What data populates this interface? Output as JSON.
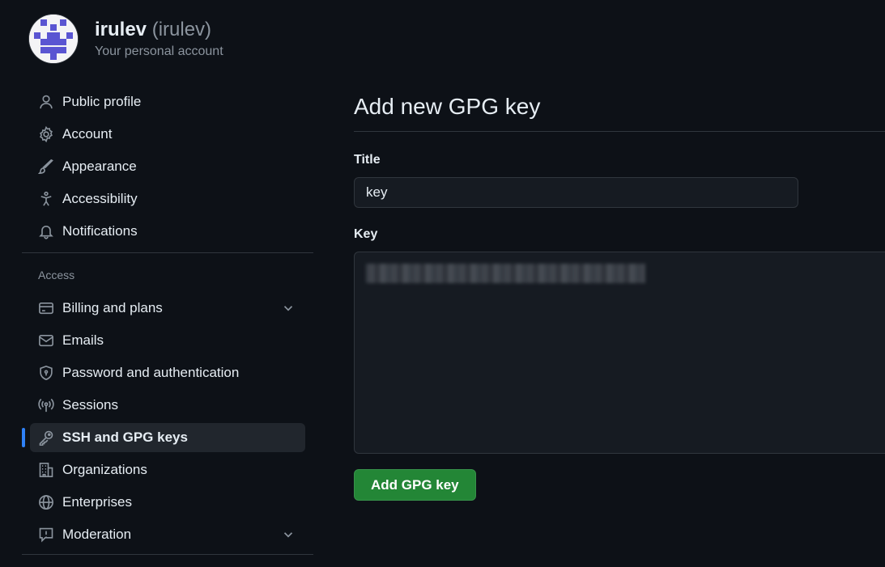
{
  "account": {
    "name": "irulev",
    "handle": "(irulev)",
    "subtitle": "Your personal account",
    "avatar_colors": {
      "background": "#f4f4f6",
      "pattern": "#5a55d2"
    }
  },
  "sidebar": {
    "items": [
      {
        "label": "Public profile",
        "icon": "person-icon"
      },
      {
        "label": "Account",
        "icon": "gear-icon"
      },
      {
        "label": "Appearance",
        "icon": "paintbrush-icon"
      },
      {
        "label": "Accessibility",
        "icon": "accessibility-icon"
      },
      {
        "label": "Notifications",
        "icon": "bell-icon"
      }
    ],
    "access_section_title": "Access",
    "access_items": [
      {
        "label": "Billing and plans",
        "icon": "credit-card-icon",
        "expandable": true
      },
      {
        "label": "Emails",
        "icon": "mail-icon"
      },
      {
        "label": "Password and authentication",
        "icon": "shield-lock-icon"
      },
      {
        "label": "Sessions",
        "icon": "broadcast-icon"
      },
      {
        "label": "SSH and GPG keys",
        "icon": "key-icon",
        "active": true
      },
      {
        "label": "Organizations",
        "icon": "organization-icon"
      },
      {
        "label": "Enterprises",
        "icon": "globe-icon"
      },
      {
        "label": "Moderation",
        "icon": "report-icon",
        "expandable": true
      }
    ]
  },
  "main": {
    "title": "Add new GPG key",
    "title_field_label": "Title",
    "title_field_value": "key",
    "key_field_label": "Key",
    "submit_label": "Add GPG key"
  },
  "colors": {
    "background": "#0d1117",
    "accent": "#2f81f7",
    "button_green": "#238636",
    "border": "#30363d"
  }
}
